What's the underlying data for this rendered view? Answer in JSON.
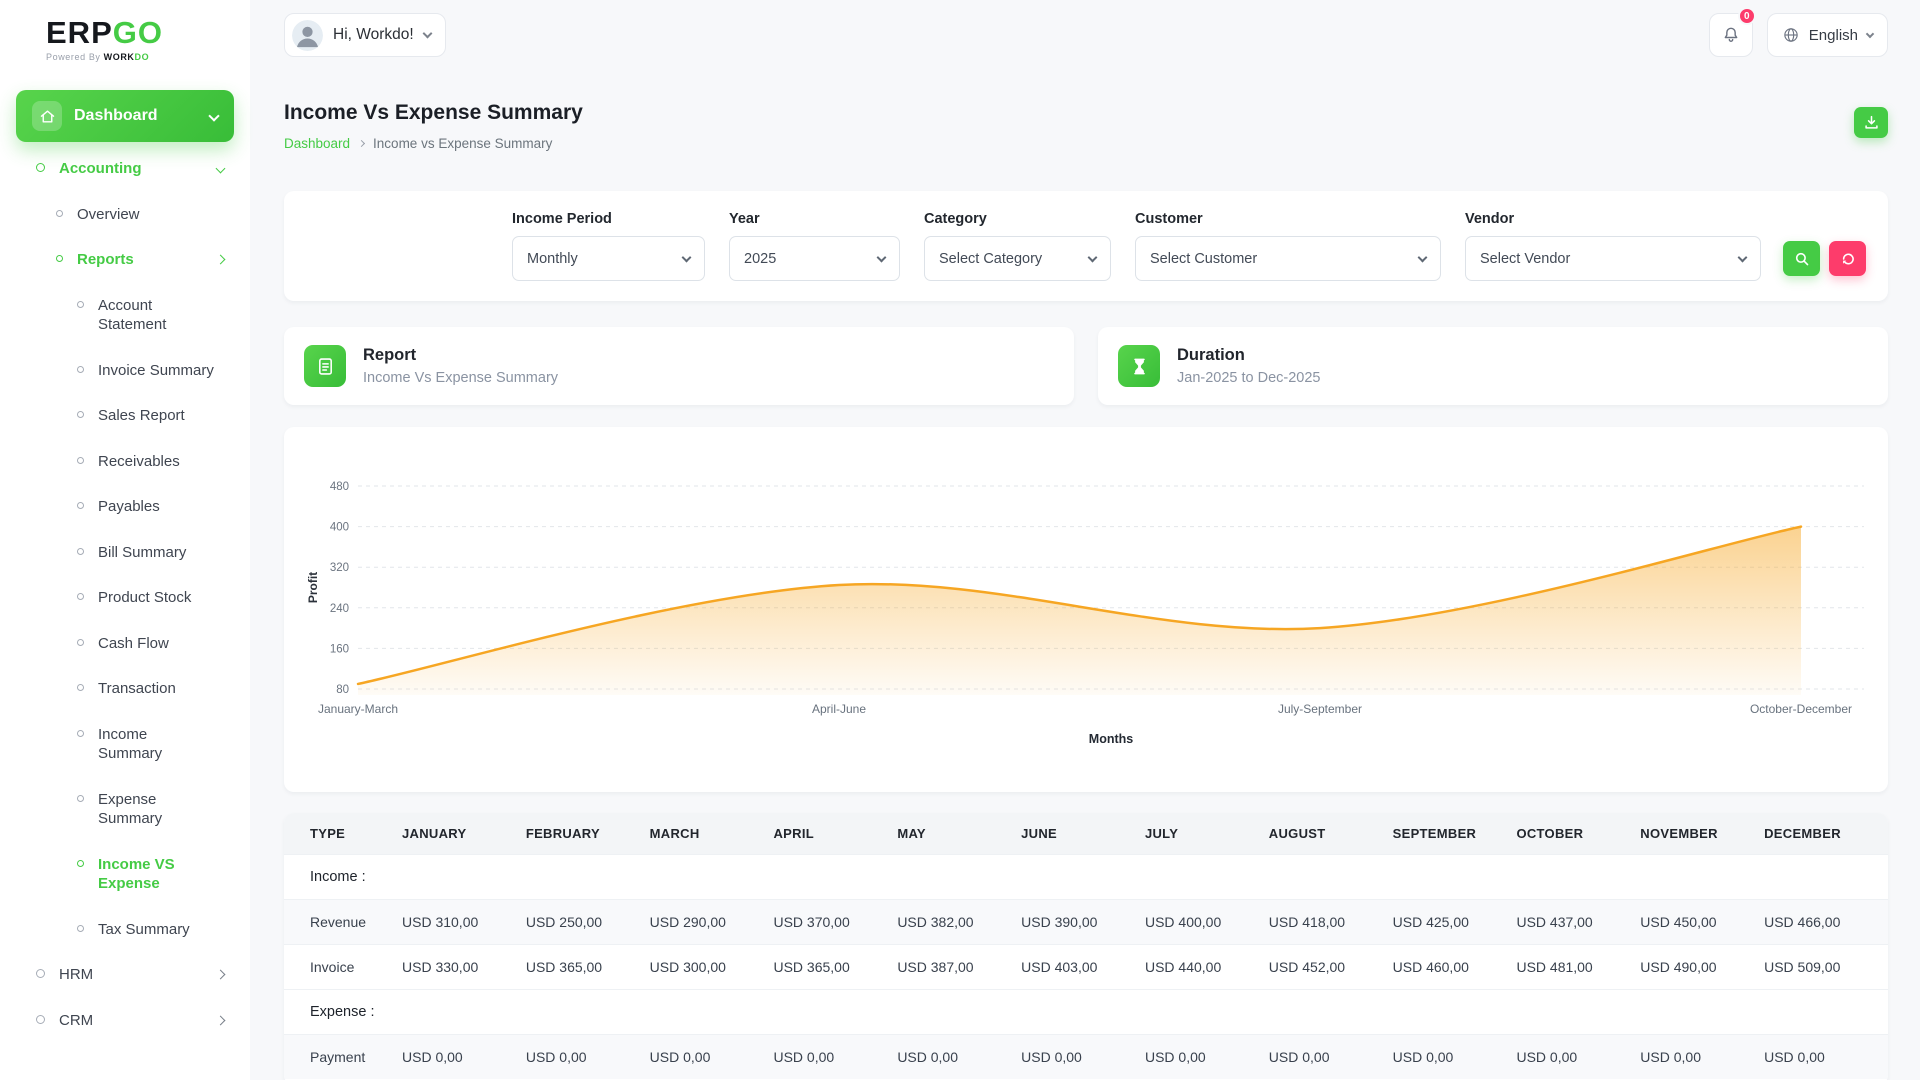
{
  "brand": {
    "name_primary": "ERP",
    "name_secondary": "GO",
    "powered_prefix": "Powered By",
    "powered_brand_primary": "WORK",
    "powered_brand_secondary": "DO"
  },
  "header": {
    "greeting": "Hi, Workdo!",
    "notification_count": "0",
    "language": "English"
  },
  "sidebar": {
    "dashboard_label": "Dashboard",
    "menu": [
      {
        "label": "Accounting",
        "level": 1,
        "trail": true,
        "chevron": "down"
      },
      {
        "label": "Overview",
        "level": 2
      },
      {
        "label": "Reports",
        "level": 2,
        "trail": true,
        "chevron": "right"
      },
      {
        "label": "Account Statement",
        "level": 3
      },
      {
        "label": "Invoice Summary",
        "level": 3
      },
      {
        "label": "Sales Report",
        "level": 3
      },
      {
        "label": "Receivables",
        "level": 3
      },
      {
        "label": "Payables",
        "level": 3
      },
      {
        "label": "Bill Summary",
        "level": 3
      },
      {
        "label": "Product Stock",
        "level": 3
      },
      {
        "label": "Cash Flow",
        "level": 3
      },
      {
        "label": "Transaction",
        "level": 3
      },
      {
        "label": "Income Summary",
        "level": 3
      },
      {
        "label": "Expense Summary",
        "level": 3
      },
      {
        "label": "Income VS Expense",
        "level": 3,
        "active": true
      },
      {
        "label": "Tax Summary",
        "level": 3
      },
      {
        "label": "HRM",
        "level": 1,
        "chevron": "right"
      },
      {
        "label": "CRM",
        "level": 1,
        "chevron": "right"
      }
    ]
  },
  "page": {
    "title": "Income Vs Expense Summary",
    "breadcrumb": [
      {
        "label": "Dashboard"
      },
      {
        "label": "Income vs Expense Summary"
      }
    ]
  },
  "filters": {
    "fields": [
      {
        "label": "Income Period",
        "value": "Monthly"
      },
      {
        "label": "Year",
        "value": "2025"
      },
      {
        "label": "Category",
        "value": "Select Category"
      },
      {
        "label": "Customer",
        "value": "Select Customer"
      },
      {
        "label": "Vendor",
        "value": "Select Vendor"
      }
    ]
  },
  "cards": {
    "report": {
      "title": "Report",
      "subtitle": "Income Vs Expense Summary"
    },
    "duration": {
      "title": "Duration",
      "subtitle": "Jan-2025 to Dec-2025"
    }
  },
  "chart_data": {
    "type": "area",
    "title": "",
    "x_categories": [
      "January-March",
      "April-June",
      "July-September",
      "October-December"
    ],
    "series": [
      {
        "name": "Profit",
        "values": [
          90,
          285,
          200,
          400
        ]
      }
    ],
    "xlabel": "Months",
    "ylabel": "Profit",
    "yticks": [
      80,
      160,
      240,
      320,
      400,
      480
    ],
    "ylim": [
      60,
      500
    ],
    "grid": "dashed-horizontal",
    "legend": "none",
    "line_color": "#f6a623",
    "fill_from": "rgba(246,166,35,0.50)",
    "fill_to": "rgba(246,166,35,0.04)"
  },
  "table": {
    "columns": [
      "TYPE",
      "JANUARY",
      "FEBRUARY",
      "MARCH",
      "APRIL",
      "MAY",
      "JUNE",
      "JULY",
      "AUGUST",
      "SEPTEMBER",
      "OCTOBER",
      "NOVEMBER",
      "DECEMBER"
    ],
    "rows": [
      {
        "type": "section",
        "label": "Income :"
      },
      {
        "type": "data",
        "label": "Revenue",
        "values": [
          "USD 310,00",
          "USD 250,00",
          "USD 290,00",
          "USD 370,00",
          "USD 382,00",
          "USD 390,00",
          "USD 400,00",
          "USD 418,00",
          "USD 425,00",
          "USD 437,00",
          "USD 450,00",
          "USD 466,00"
        ]
      },
      {
        "type": "data",
        "label": "Invoice",
        "values": [
          "USD 330,00",
          "USD 365,00",
          "USD 300,00",
          "USD 365,00",
          "USD 387,00",
          "USD 403,00",
          "USD 440,00",
          "USD 452,00",
          "USD 460,00",
          "USD 481,00",
          "USD 490,00",
          "USD 509,00"
        ]
      },
      {
        "type": "section",
        "label": "Expense :"
      },
      {
        "type": "data",
        "label": "Payment",
        "values": [
          "USD 0,00",
          "USD 0,00",
          "USD 0,00",
          "USD 0,00",
          "USD 0,00",
          "USD 0,00",
          "USD 0,00",
          "USD 0,00",
          "USD 0,00",
          "USD 0,00",
          "USD 0,00",
          "USD 0,00"
        ]
      }
    ]
  },
  "colors": {
    "accent_green": "#45cb45",
    "accent_pink": "#fd3c6b",
    "chart_orange": "#f6a623"
  }
}
